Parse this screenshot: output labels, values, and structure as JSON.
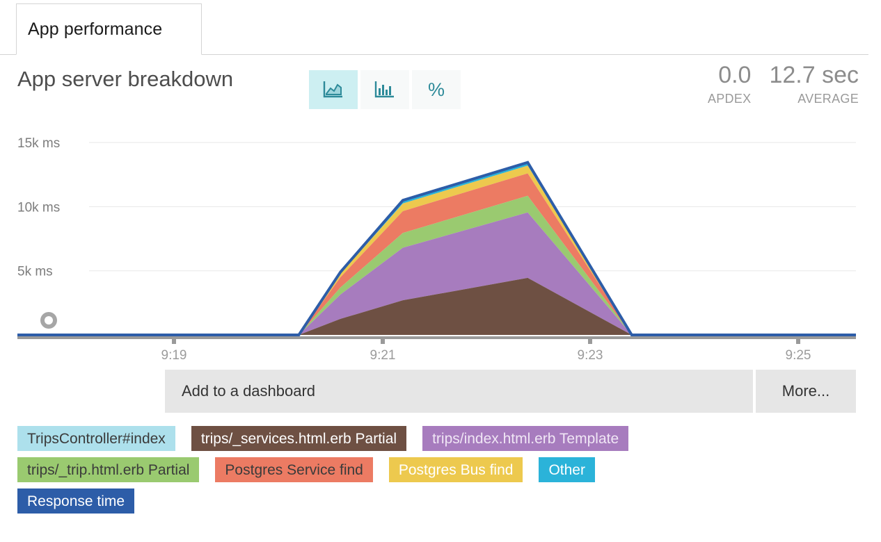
{
  "tabs": [
    {
      "label": "App performance",
      "active": true
    }
  ],
  "header": {
    "title": "App server breakdown",
    "view_modes": [
      {
        "name": "area-chart",
        "icon": "area-chart-icon",
        "active": true
      },
      {
        "name": "bar-chart",
        "icon": "bar-chart-icon",
        "active": false
      },
      {
        "name": "percent",
        "icon": "percent-icon",
        "label": "%",
        "active": false
      }
    ],
    "metrics": [
      {
        "value": "0.0",
        "label": "APDEX"
      },
      {
        "value": "12.7 sec",
        "label": "AVERAGE"
      }
    ]
  },
  "actions": {
    "add_to_dashboard": "Add to a dashboard",
    "more": "More..."
  },
  "legend": [
    [
      {
        "label": "TripsController#index",
        "color": "#ade0ec",
        "text_color": "#3b3b3b"
      },
      {
        "label": "trips/_services.html.erb Partial",
        "color": "#6e5043",
        "text_color": "#ffffff"
      },
      {
        "label": "trips/index.html.erb Template",
        "color": "#a77cbe",
        "text_color": "#f0e6f5"
      }
    ],
    [
      {
        "label": "trips/_trip.html.erb Partial",
        "color": "#9aca70",
        "text_color": "#3b3b3b"
      },
      {
        "label": "Postgres Service find",
        "color": "#ec7b63",
        "text_color": "#3b3b3b"
      },
      {
        "label": "Postgres Bus find",
        "color": "#edc94e",
        "text_color": "#ffffff"
      },
      {
        "label": "Other",
        "color": "#2bb3d9",
        "text_color": "#ffffff"
      }
    ],
    [
      {
        "label": "Response time",
        "color": "#2d5da8",
        "text_color": "#ffffff"
      }
    ]
  ],
  "chart_data": {
    "type": "area",
    "title": "App server breakdown",
    "stacked": true,
    "xlabel": "",
    "ylabel": "ms",
    "ylim": [
      0,
      16200
    ],
    "yticks": [
      5000,
      10000,
      15000
    ],
    "ytick_labels": [
      "5k ms",
      "10k ms",
      "15k ms"
    ],
    "xticks": [
      "9:19",
      "9:21",
      "9:23",
      "9:25"
    ],
    "xlim_labels": [
      "9:18",
      "9:26"
    ],
    "grid": "horizontal",
    "legend_position": "bottom",
    "marker": {
      "name": "response-time-point",
      "x": "9:18.4",
      "y": 0,
      "style": "gray-ring"
    },
    "x": [
      "9:20.2",
      "9:20.6",
      "9:21.2",
      "9:22.4",
      "9:23.4"
    ],
    "series": [
      {
        "name": "trips/_services.html.erb Partial",
        "color": "#6e5043",
        "values": [
          0,
          1250,
          2700,
          4450,
          0
        ]
      },
      {
        "name": "trips/index.html.erb Template",
        "color": "#a77cbe",
        "values": [
          0,
          1900,
          4100,
          5100,
          0
        ]
      },
      {
        "name": "trips/_trip.html.erb Partial",
        "color": "#9aca70",
        "values": [
          0,
          550,
          1150,
          1300,
          0
        ]
      },
      {
        "name": "Postgres Service find",
        "color": "#ec7b63",
        "values": [
          0,
          800,
          1700,
          1750,
          0
        ]
      },
      {
        "name": "Postgres Bus find",
        "color": "#edc94e",
        "values": [
          0,
          280,
          600,
          600,
          0
        ]
      },
      {
        "name": "Other",
        "color": "#2bb3d9",
        "values": [
          0,
          90,
          200,
          200,
          0
        ]
      },
      {
        "name": "TripsController#index",
        "color": "#ade0ec",
        "values": [
          0,
          30,
          50,
          50,
          0
        ]
      }
    ],
    "line_series": {
      "name": "Response time",
      "color": "#2d5da8",
      "values": [
        0,
        4900,
        10500,
        13450,
        0
      ]
    }
  }
}
